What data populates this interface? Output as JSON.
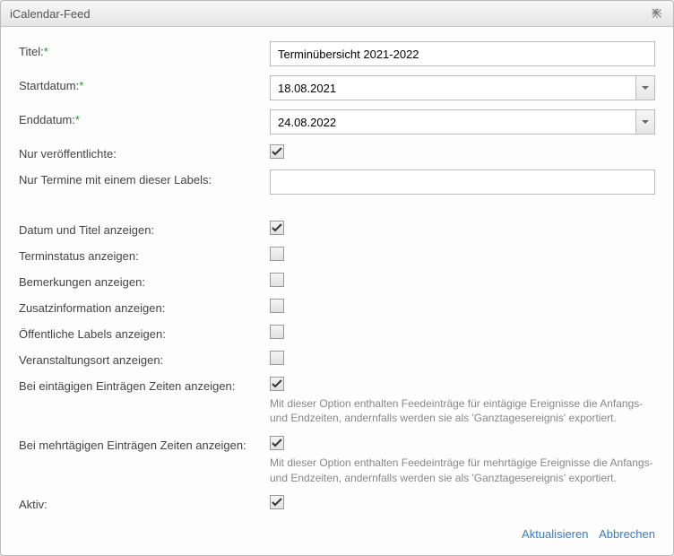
{
  "dialog": {
    "title": "iCalendar-Feed"
  },
  "fields": {
    "title_label": "Titel:",
    "title_value": "Terminübersicht 2021-2022",
    "start_label": "Startdatum:",
    "start_value": "18.08.2021",
    "end_label": "Enddatum:",
    "end_value": "24.08.2022",
    "published_label": "Nur veröffentlichte:",
    "labels_label": "Nur Termine mit einem dieser Labels:",
    "labels_value": "",
    "showdate_label": "Datum und Titel anzeigen:",
    "status_label": "Terminstatus anzeigen:",
    "remarks_label": "Bemerkungen anzeigen:",
    "extra_label": "Zusatzinformation anzeigen:",
    "publabels_label": "Öffentliche Labels anzeigen:",
    "venue_label": "Veranstaltungsort anzeigen:",
    "single_label": "Bei eintägigen Einträgen Zeiten anzeigen:",
    "single_help": "Mit dieser Option enthalten Feedeinträge für eintägige Ereignisse die Anfangs- und Endzeiten, andernfalls werden sie als 'Ganztagesereignis' exportiert.",
    "multi_label": "Bei mehrtägigen Einträgen Zeiten anzeigen:",
    "multi_help": "Mit dieser Option enthalten Feedeinträge für mehrtägige Ereignisse die Anfangs- und Endzeiten, andernfalls werden sie als 'Ganztagesereignis' exportiert.",
    "active_label": "Aktiv:"
  },
  "buttons": {
    "update": "Aktualisieren",
    "cancel": "Abbrechen"
  },
  "required_marker": "*"
}
